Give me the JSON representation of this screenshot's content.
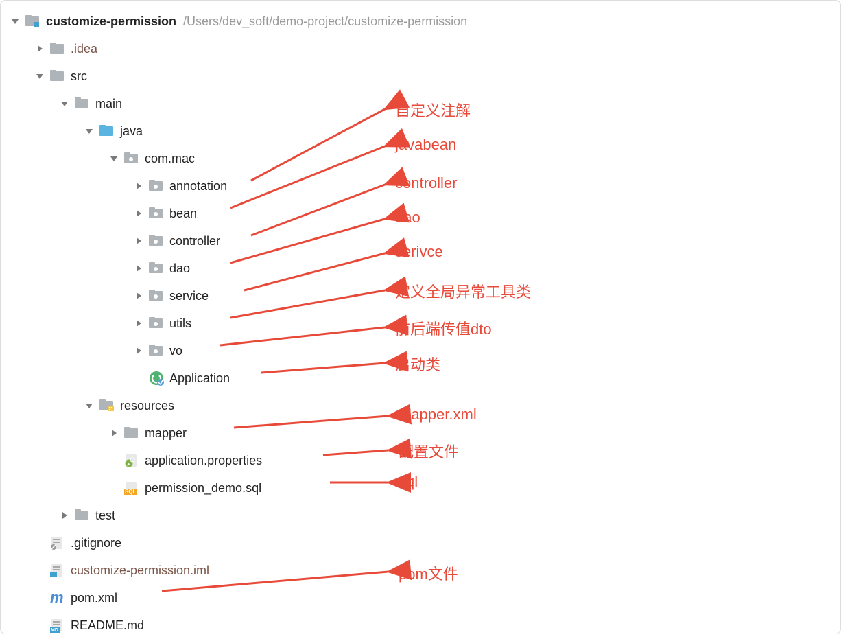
{
  "root": {
    "name": "customize-permission",
    "path": "/Users/dev_soft/demo-project/customize-permission"
  },
  "tree": {
    "idea": ".idea",
    "src": "src",
    "main": "main",
    "java": "java",
    "commac": "com.mac",
    "annotation": "annotation",
    "bean": "bean",
    "controller": "controller",
    "dao": "dao",
    "service": "service",
    "utils": "utils",
    "vo": "vo",
    "application": "Application",
    "resources": "resources",
    "mapper": "mapper",
    "appprops": "application.properties",
    "sql": "permission_demo.sql",
    "test": "test",
    "gitignore": ".gitignore",
    "iml": "customize-permission.iml",
    "pom": "pom.xml",
    "readme": "README.md"
  },
  "annotations": {
    "a1": "自定义注解",
    "a2": "javabean",
    "a3": "controller",
    "a4": "dao",
    "a5": "serivce",
    "a6": "定义全局异常工具类",
    "a7": "前后端传值dto",
    "a8": "启动类",
    "a9": "mapper.xml",
    "a10": "配置文件",
    "a11": "sql",
    "a12": "pom文件"
  }
}
